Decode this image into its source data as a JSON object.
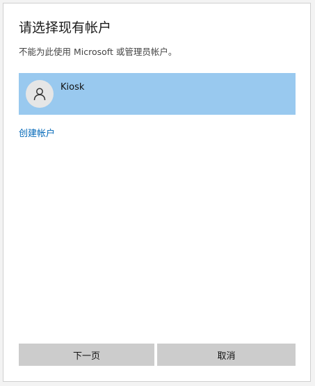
{
  "dialog": {
    "title": "请选择现有帐户",
    "subtitle": "不能为此使用 Microsoft 或管理员帐户。"
  },
  "accounts": [
    {
      "name": "Kiosk",
      "icon": "person-icon",
      "selected": true
    }
  ],
  "links": {
    "create_account": "创建帐户"
  },
  "buttons": {
    "next": "下一页",
    "cancel": "取消"
  },
  "colors": {
    "selected_row": "#99c9ef",
    "link": "#0067b8",
    "button_bg": "#cccccc",
    "avatar_bg": "#e6e6e6"
  }
}
